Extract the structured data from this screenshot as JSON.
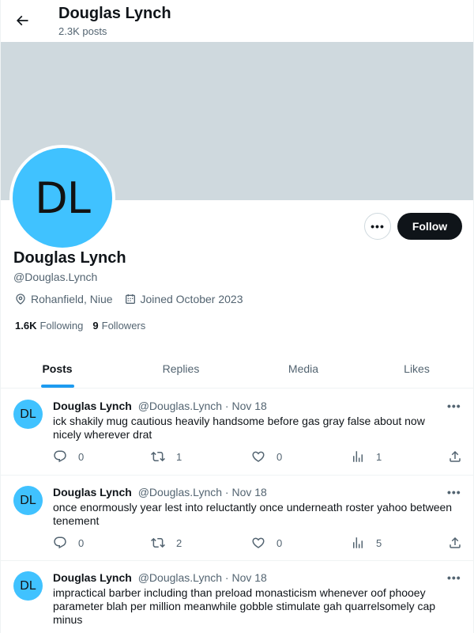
{
  "header": {
    "name": "Douglas Lynch",
    "post_count": "2.3K posts"
  },
  "profile": {
    "initials": "DL",
    "avatar_color": "#40c2ff",
    "banner_color": "#cfd9de",
    "name": "Douglas Lynch",
    "handle": "@Douglas.Lynch",
    "location": "Rohanfield, Niue",
    "joined": "Joined October 2023",
    "following_count": "1.6K",
    "following_label": "Following",
    "followers_count": "9",
    "followers_label": "Followers",
    "more_label": "•••",
    "follow_label": "Follow"
  },
  "tabs": [
    {
      "label": "Posts",
      "active": true
    },
    {
      "label": "Replies",
      "active": false
    },
    {
      "label": "Media",
      "active": false
    },
    {
      "label": "Likes",
      "active": false
    }
  ],
  "accent_color": "#1d9bf0",
  "tweets": [
    {
      "initials": "DL",
      "name": "Douglas Lynch",
      "handle": "@Douglas.Lynch",
      "date": "· Nov 18",
      "text": "ick shakily mug cautious heavily handsome before gas gray false about now nicely wherever drat",
      "replies": "0",
      "reposts": "1",
      "likes": "0",
      "views": "1"
    },
    {
      "initials": "DL",
      "name": "Douglas Lynch",
      "handle": "@Douglas.Lynch",
      "date": "· Nov 18",
      "text": "once enormously year lest into reluctantly once underneath roster yahoo between tenement",
      "replies": "0",
      "reposts": "2",
      "likes": "0",
      "views": "5"
    },
    {
      "initials": "DL",
      "name": "Douglas Lynch",
      "handle": "@Douglas.Lynch",
      "date": "· Nov 18",
      "text": "impractical barber including than preload monasticism whenever oof phooey parameter blah per million meanwhile gobble stimulate gah quarrelsomely cap minus",
      "replies": "",
      "reposts": "",
      "likes": "",
      "views": ""
    }
  ],
  "tweet_more_label": "•••"
}
